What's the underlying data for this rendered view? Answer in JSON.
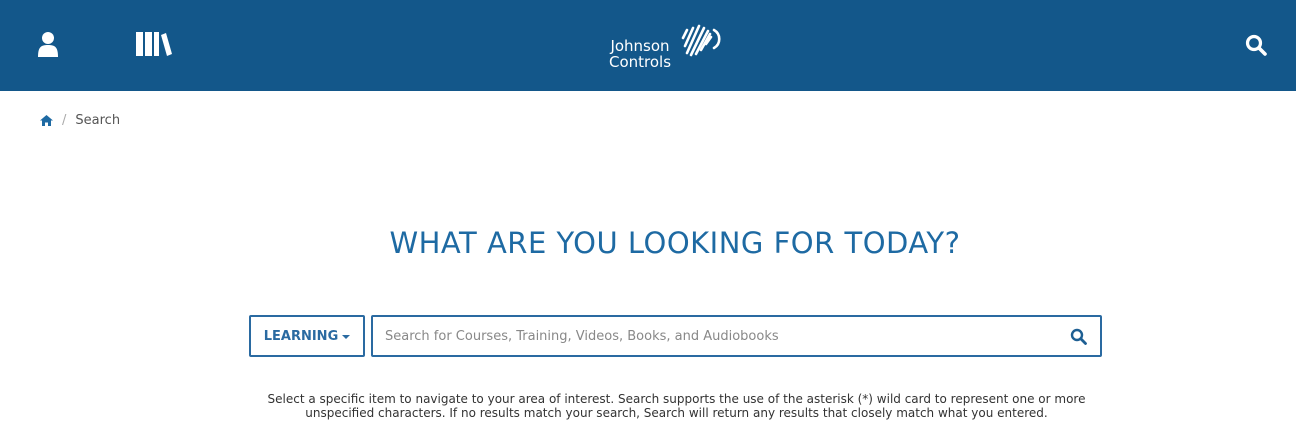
{
  "header": {
    "logo_line1": "Johnson",
    "logo_line2": "Controls",
    "icons": [
      "user-icon",
      "library-icon",
      "search-icon"
    ],
    "bar_color": "#13578a"
  },
  "breadcrumb": {
    "home_icon": "home-icon",
    "current": "Search"
  },
  "main": {
    "headline": "WHAT ARE YOU LOOKING FOR TODAY?",
    "scope_label": "LEARNING",
    "search_value": "",
    "search_placeholder": "Search for Courses, Training, Videos, Books, and Audiobooks",
    "help_text": "Select a specific item to navigate to your area of interest. Search supports the use of the asterisk (*) wild card to represent one or more unspecified characters. If no results match your search, Search will return any results that closely match what you entered.",
    "accent_color": "#2a6aa1"
  }
}
